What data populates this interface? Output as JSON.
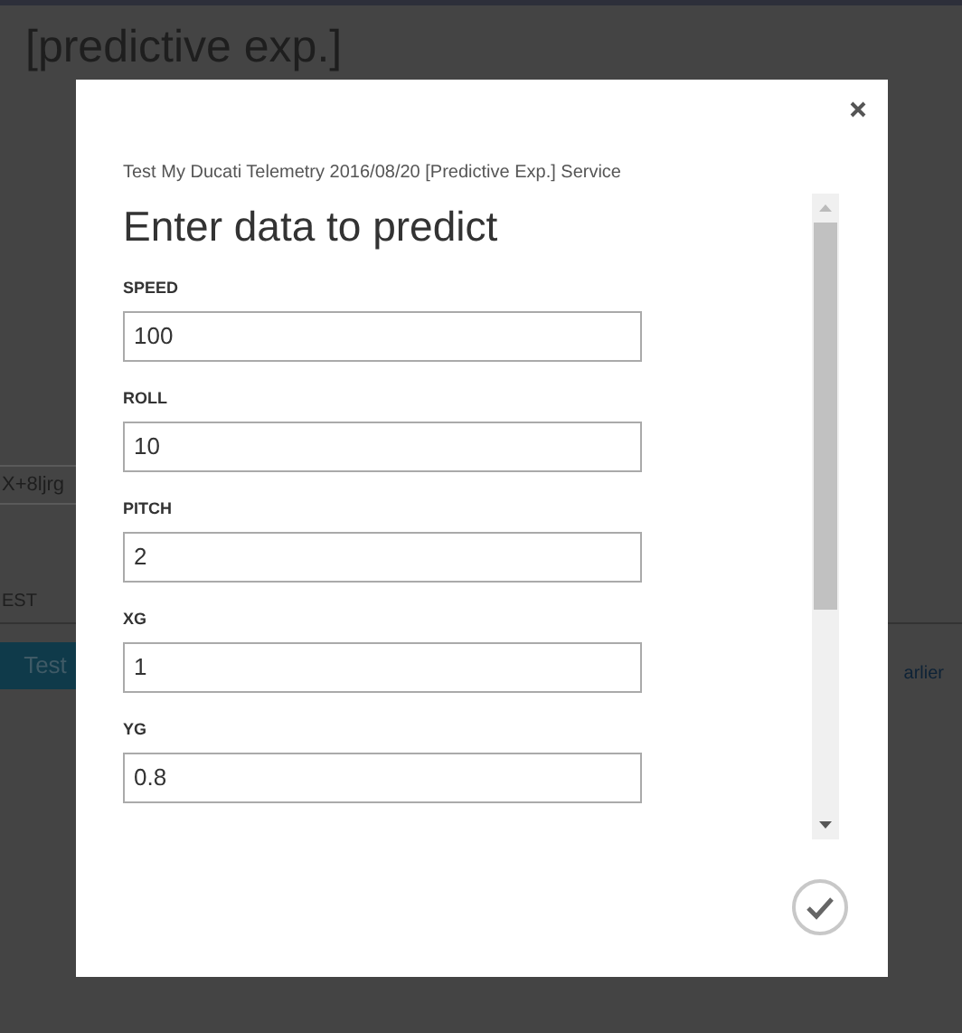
{
  "background": {
    "title": "[predictive exp.]",
    "key_field": {
      "value": "X+8ljrg"
    },
    "section_label": "EST",
    "test_button": "Test",
    "link_text": "arlier"
  },
  "dialog": {
    "service_name": "Test My Ducati Telemetry 2016/08/20 [Predictive Exp.] Service",
    "heading": "Enter data to predict",
    "fields": [
      {
        "label": "SPEED",
        "value": "100"
      },
      {
        "label": "ROLL",
        "value": "10"
      },
      {
        "label": "PITCH",
        "value": "2"
      },
      {
        "label": "XG",
        "value": "1"
      },
      {
        "label": "YG",
        "value": "0.8"
      }
    ]
  }
}
